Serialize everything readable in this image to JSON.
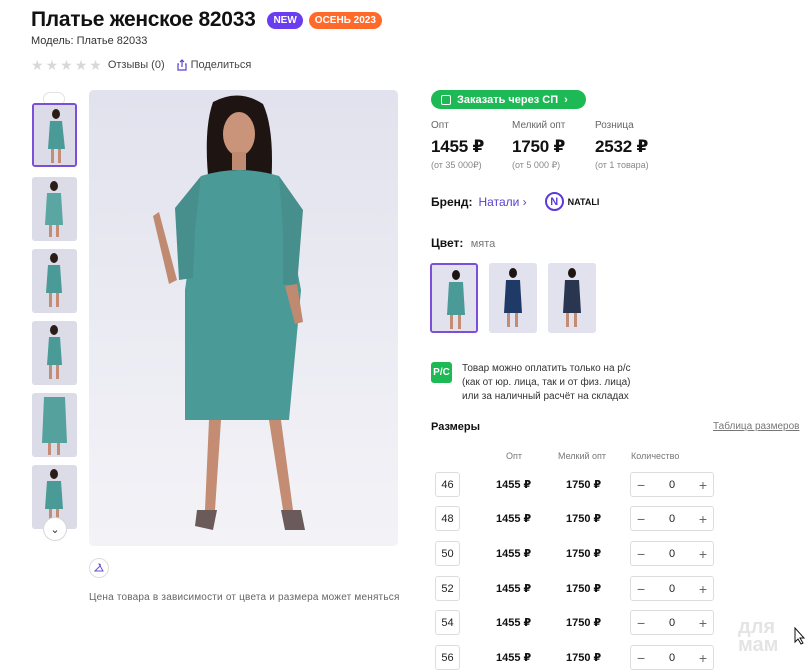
{
  "product": {
    "title": "Платье женское 82033",
    "badge_new": "NEW",
    "badge_season": "ОСЕНЬ 2023",
    "model": "Модель: Платье 82033"
  },
  "reviews": {
    "label": "Отзывы (0)",
    "rating": 0,
    "max_rating": 5
  },
  "share": {
    "label": "Поделиться"
  },
  "order_button": {
    "label": "Заказать через СП"
  },
  "prices": [
    {
      "label": "Опт",
      "value": "1455 ₽",
      "sub": "(от 35 000₽)"
    },
    {
      "label": "Мелкий опт",
      "value": "1750 ₽",
      "sub": "(от 5 000 ₽)"
    },
    {
      "label": "Розница",
      "value": "2532 ₽",
      "sub": "(от 1 товара)"
    }
  ],
  "brand": {
    "label": "Бренд:",
    "value": "Натали",
    "logo_text": "NATALI",
    "logo_letter": "N"
  },
  "color": {
    "label": "Цвет:",
    "value": "мята"
  },
  "payment_note": {
    "icon_text": "P/C",
    "lines": [
      "Товар можно оплатить только на р/с",
      "(как от юр. лица, так и от физ. лица)",
      "или за наличный расчёт на складах"
    ]
  },
  "sizes": {
    "title": "Размеры",
    "table_link": "Таблица размеров",
    "headers": {
      "opt": "Опт",
      "small_opt": "Мелкий опт",
      "qty": "Количество"
    },
    "rows": [
      {
        "size": "46",
        "opt": "1455 ₽",
        "small_opt": "1750 ₽",
        "qty": "0"
      },
      {
        "size": "48",
        "opt": "1455 ₽",
        "small_opt": "1750 ₽",
        "qty": "0"
      },
      {
        "size": "50",
        "opt": "1455 ₽",
        "small_opt": "1750 ₽",
        "qty": "0"
      },
      {
        "size": "52",
        "opt": "1455 ₽",
        "small_opt": "1750 ₽",
        "qty": "0"
      },
      {
        "size": "54",
        "opt": "1455 ₽",
        "small_opt": "1750 ₽",
        "qty": "0"
      },
      {
        "size": "56",
        "opt": "1455 ₽",
        "small_opt": "1750 ₽",
        "qty": "0"
      }
    ]
  },
  "price_note": "Цена товара в зависимости от цвета и размера может меняться",
  "watermark": "для мам",
  "colors": {
    "accent": "#7b4fd8",
    "green": "#1db954",
    "dress_mint": "#4a9a97",
    "dress_navy": "#1f3a66"
  }
}
